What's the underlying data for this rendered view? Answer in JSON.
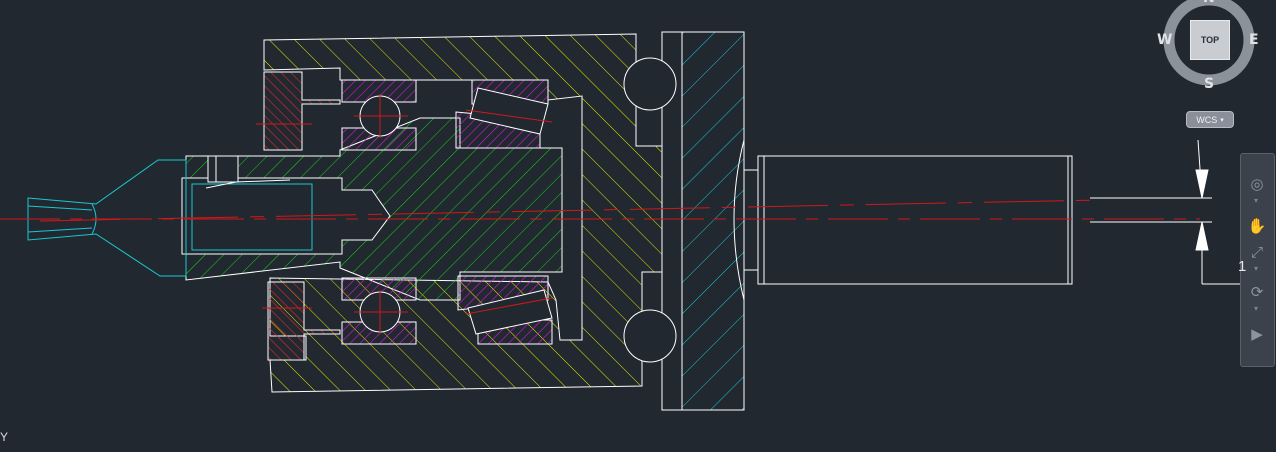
{
  "viewcube": {
    "north": "N",
    "south": "S",
    "east": "E",
    "west": "W",
    "face": "TOP",
    "wcs_label": "WCS"
  },
  "dimension": {
    "text": "1"
  },
  "ucs": {
    "y_axis_label": "Y"
  },
  "navbar": {
    "tools": [
      "steering-wheel",
      "pan",
      "zoom-extents",
      "orbit",
      "showmotion"
    ]
  },
  "layer_colors": {
    "background": "#212830",
    "outline": "#ffffff",
    "housing_hatch": "#e6e600",
    "shaft_hatch": "#19d219",
    "bearing_hatch": "#d41ad4",
    "seal_hatch": "#dd2a2a",
    "flange_hatch": "#19c8d2",
    "centerline": "#d01919",
    "tool_tip": "#19c8d2"
  }
}
